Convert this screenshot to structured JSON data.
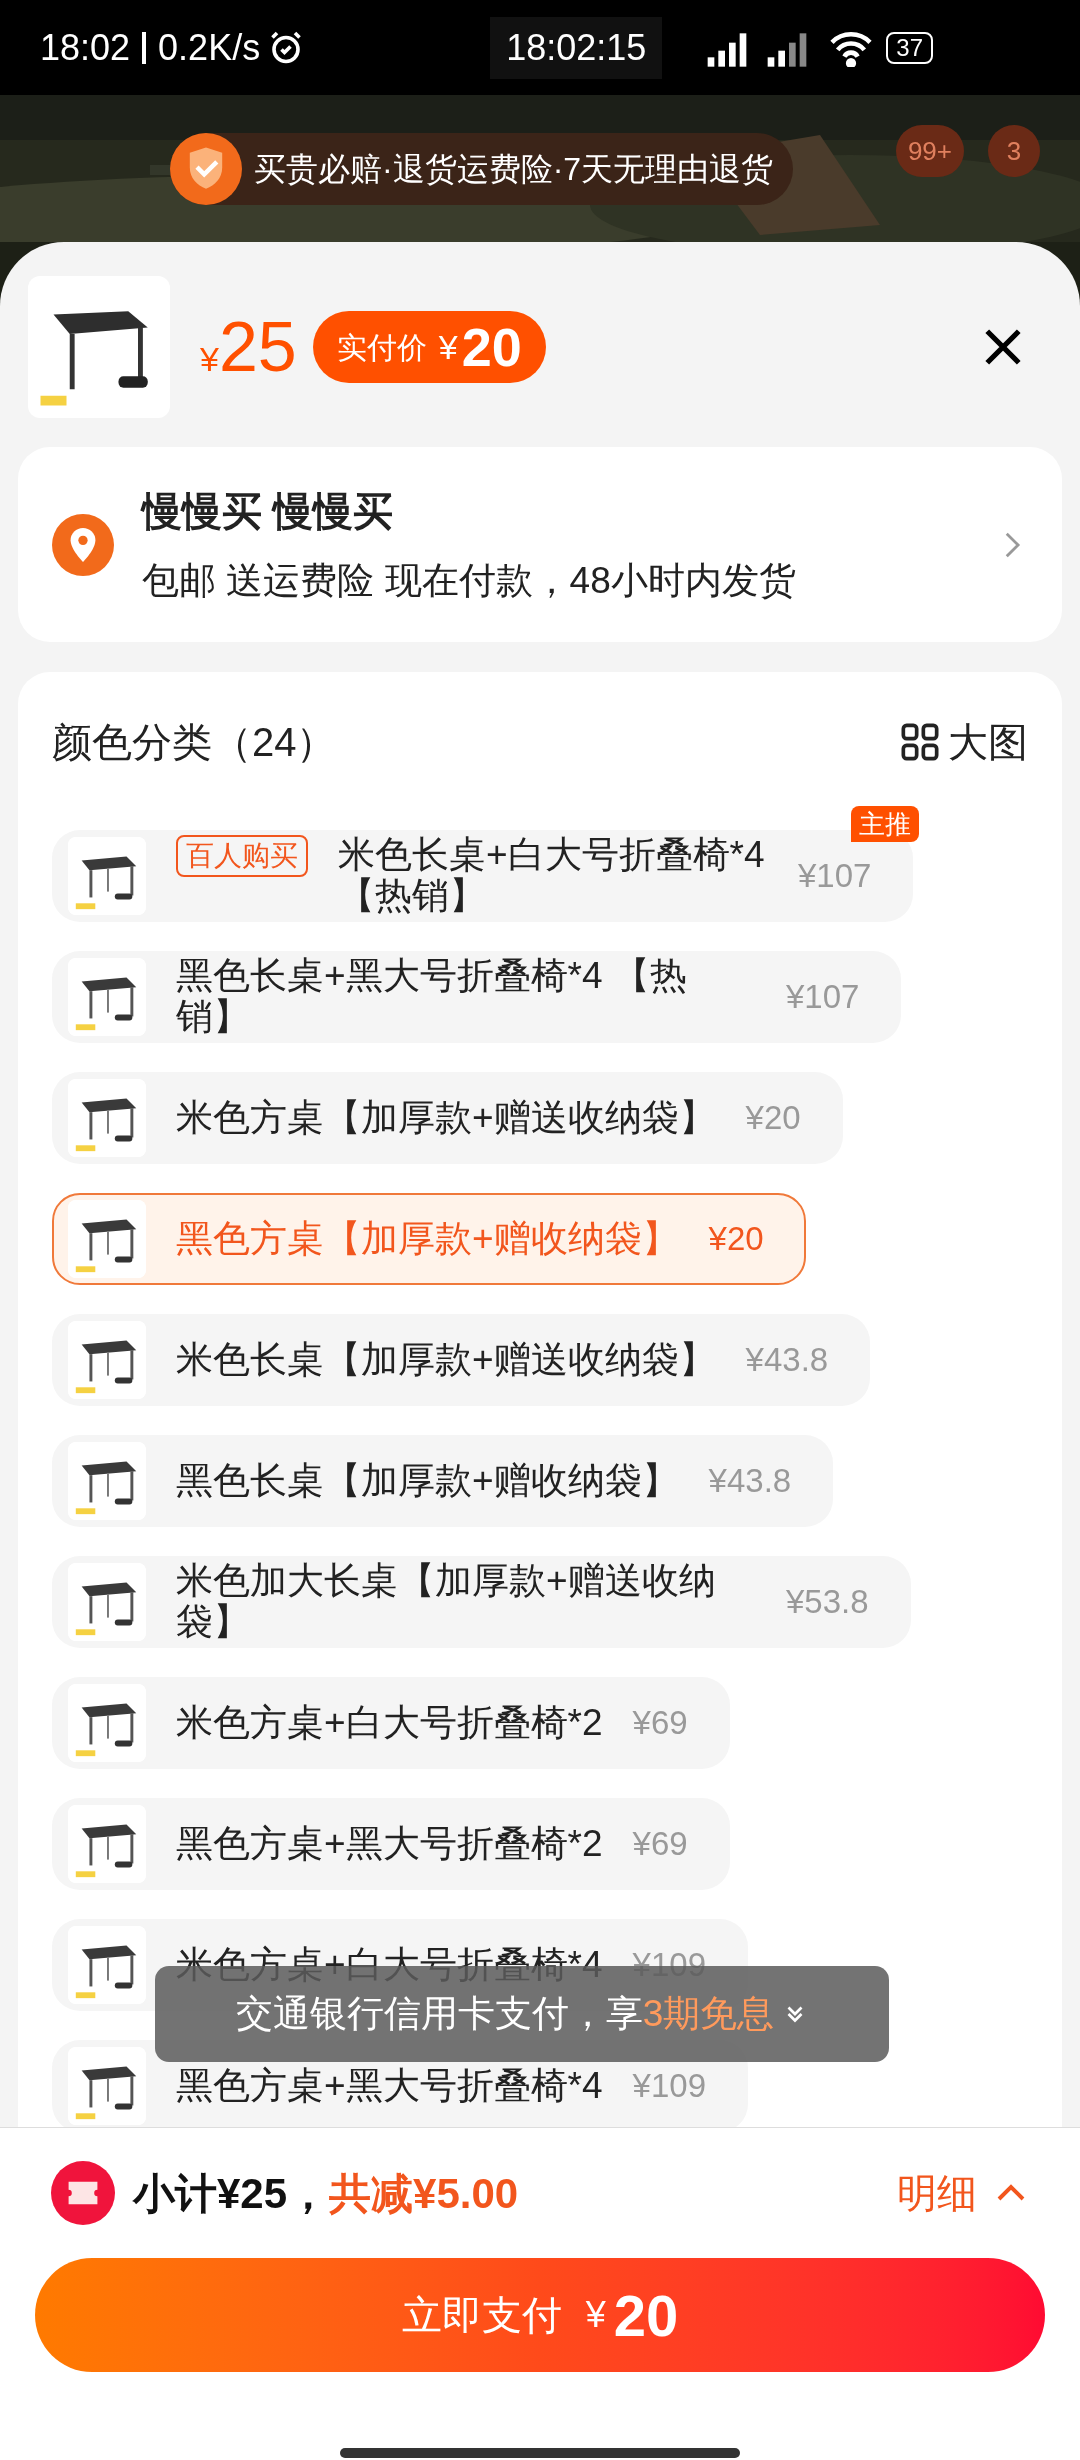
{
  "status_bar": {
    "time": "18:02",
    "speed": "0.2K/s",
    "clock": "18:02:15",
    "battery": "37"
  },
  "background": {
    "promo": "买贵必赔·退货运费险·7天无理由退货",
    "badges": [
      "99+",
      "3"
    ]
  },
  "product": {
    "price_symbol": "¥",
    "price": "25",
    "pay_label": "实付价",
    "pay_symbol": "¥",
    "pay_price": "20"
  },
  "address": {
    "name": "慢慢买 慢慢买",
    "detail": "包邮 送运费险 现在付款，48小时内发货"
  },
  "options": {
    "title": "颜色分类（24）",
    "view_toggle": "大图",
    "items": [
      {
        "name": "米色长桌+白大号折叠椅*4 【热销】",
        "price": "¥107",
        "selected": false,
        "badge": "百人购买",
        "tag": "主推"
      },
      {
        "name": "黑色长桌+黑大号折叠椅*4 【热销】",
        "price": "¥107",
        "selected": false
      },
      {
        "name": "米色方桌【加厚款+赠送收纳袋】",
        "price": "¥20",
        "selected": false
      },
      {
        "name": "黑色方桌【加厚款+赠收纳袋】",
        "price": "¥20",
        "selected": true
      },
      {
        "name": "米色长桌【加厚款+赠送收纳袋】",
        "price": "¥43.8",
        "selected": false
      },
      {
        "name": "黑色长桌【加厚款+赠收纳袋】",
        "price": "¥43.8",
        "selected": false
      },
      {
        "name": "米色加大长桌【加厚款+赠送收纳袋】",
        "price": "¥53.8",
        "selected": false
      },
      {
        "name": "米色方桌+白大号折叠椅*2",
        "price": "¥69",
        "selected": false
      },
      {
        "name": "黑色方桌+黑大号折叠椅*2",
        "price": "¥69",
        "selected": false
      },
      {
        "name": "米色方桌+白大号折叠椅*4",
        "price": "¥109",
        "selected": false
      },
      {
        "name": "黑色方桌+黑大号折叠椅*4",
        "price": "¥109",
        "selected": false
      }
    ]
  },
  "toast": {
    "text": "交通银行信用卡支付，享",
    "highlight": "3期免息"
  },
  "footer": {
    "subtotal": "小计¥25，",
    "discount": "共减¥5.00",
    "detail": "明细",
    "pay_label": "立即支付",
    "pay_symbol": "¥",
    "pay_amount": "20"
  }
}
